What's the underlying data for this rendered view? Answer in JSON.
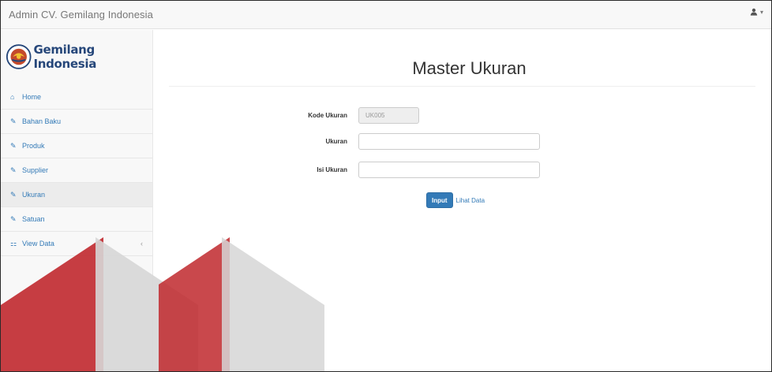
{
  "navbar": {
    "brand": "Admin CV. Gemilang Indonesia",
    "user_icon": "user-icon",
    "caret": "▾"
  },
  "sidebar": {
    "logo_text": "Gemilang Indonesia",
    "items": [
      {
        "label": "Home",
        "icon": "home-icon",
        "glyph": "⌂"
      },
      {
        "label": "Bahan Baku",
        "icon": "edit-icon",
        "glyph": "✎"
      },
      {
        "label": "Produk",
        "icon": "edit-icon",
        "glyph": "✎"
      },
      {
        "label": "Supplier",
        "icon": "edit-icon",
        "glyph": "✎"
      },
      {
        "label": "Ukuran",
        "icon": "edit-icon",
        "glyph": "✎",
        "active": true
      },
      {
        "label": "Satuan",
        "icon": "edit-icon",
        "glyph": "✎"
      },
      {
        "label": "View Data",
        "icon": "sitemap-icon",
        "glyph": "⚏",
        "has_arrow": true
      }
    ]
  },
  "main": {
    "title": "Master Ukuran",
    "form": {
      "kode_label": "Kode Ukuran",
      "kode_value": "UK005",
      "ukuran_label": "Ukuran",
      "ukuran_value": "",
      "isi_label": "Isi Ukuran",
      "isi_value": ""
    },
    "input_button": "Input",
    "lihat_link": "Lihat Data"
  },
  "colors": {
    "primary": "#337ab7",
    "watermark_red": "#c0282d",
    "watermark_gray": "#d6d6d6"
  }
}
